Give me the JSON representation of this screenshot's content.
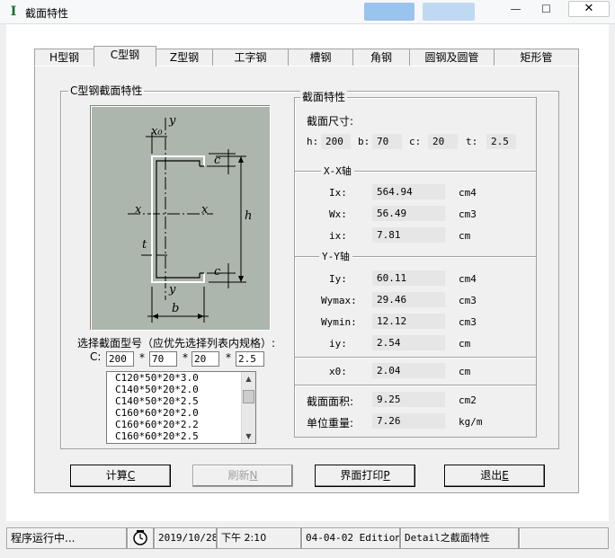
{
  "window": {
    "title": "截面特性",
    "close_glyph": "✕",
    "minimize_glyph": "—",
    "maximize_glyph": "☐"
  },
  "tabs": [
    {
      "label": "H型钢"
    },
    {
      "label": "C型钢"
    },
    {
      "label": "Z型钢"
    },
    {
      "label": "工字钢"
    },
    {
      "label": "槽钢"
    },
    {
      "label": "角钢"
    },
    {
      "label": "圆钢及圆管"
    },
    {
      "label": "矩形管"
    }
  ],
  "left_group": {
    "title": "C型钢截面特性",
    "diagram_labels": {
      "y_top": "y",
      "x0": "x₀",
      "c_top": "c",
      "x_left": "x",
      "x_right": "x",
      "h": "h",
      "t": "t",
      "c_bottom": "c",
      "y_bottom": "y",
      "b": "b"
    },
    "select_label": "选择截面型号（应优先选择列表内规格）:",
    "c_label": "C:",
    "inputs": {
      "h": "200",
      "b": "70",
      "c": "20",
      "t": "2.5"
    },
    "star": "*",
    "list": [
      "C120*50*20*3.0",
      "C140*50*20*2.0",
      "C140*50*20*2.5",
      "C160*60*20*2.0",
      "C160*60*20*2.2",
      "C160*60*20*2.5"
    ]
  },
  "right_group": {
    "title": "截面特性",
    "dims_title": "截面尺寸:",
    "dims": [
      {
        "label": "h:",
        "value": "200"
      },
      {
        "label": "b:",
        "value": "70"
      },
      {
        "label": "c:",
        "value": "20"
      },
      {
        "label": "t:",
        "value": "2.5"
      }
    ],
    "xx_title": "X-X轴",
    "xx": [
      {
        "label": "Ix:",
        "value": "564.94",
        "unit": "cm4"
      },
      {
        "label": "Wx:",
        "value": "56.49",
        "unit": "cm3"
      },
      {
        "label": "ix:",
        "value": "7.81",
        "unit": "cm"
      }
    ],
    "yy_title": "Y-Y轴",
    "yy": [
      {
        "label": "Iy:",
        "value": "60.11",
        "unit": "cm4"
      },
      {
        "label": "Wymax:",
        "value": "29.46",
        "unit": "cm3"
      },
      {
        "label": "Wymin:",
        "value": "12.12",
        "unit": "cm3"
      },
      {
        "label": "iy:",
        "value": "2.54",
        "unit": "cm"
      }
    ],
    "x0": {
      "label": "x0:",
      "value": "2.04",
      "unit": "cm"
    },
    "area": {
      "label": "截面面积:",
      "value": "9.25",
      "unit": "cm2"
    },
    "weight": {
      "label": "单位重量:",
      "value": "7.26",
      "unit": "kg/m"
    }
  },
  "buttons": {
    "calc": {
      "text": "计算",
      "key": "C"
    },
    "refresh": {
      "text": "刷新",
      "key": "N"
    },
    "print": {
      "text": "界面打印",
      "key": "P"
    },
    "exit": {
      "text": "退出",
      "key": "E"
    }
  },
  "statusbar": {
    "status": "程序运行中...",
    "date": "2019/10/28",
    "time": "下午 2:10",
    "edition": "04-04-02 Edition",
    "module": "Detail之截面特性",
    "clock_icon": "clock-icon"
  }
}
